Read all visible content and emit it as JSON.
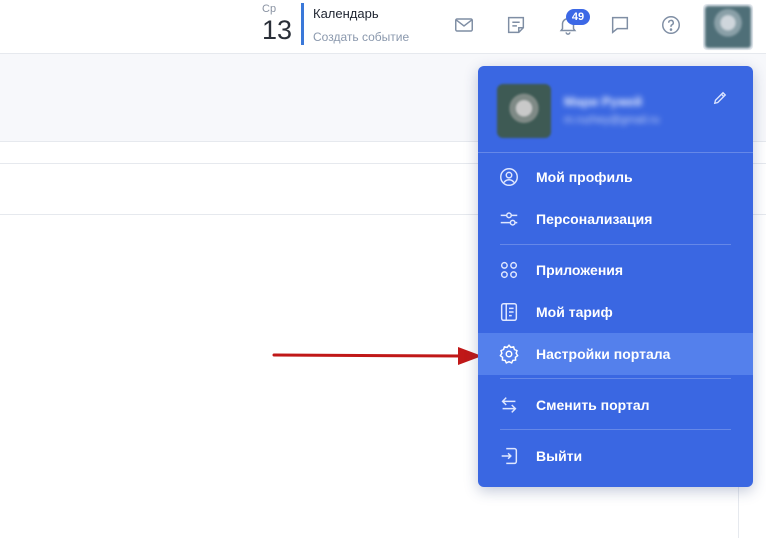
{
  "header": {
    "date_dow": "Ср",
    "date_day": "13",
    "calendar_title": "Календарь",
    "calendar_sub": "Создать событие",
    "notifications_count": "49",
    "accent": "#3a78d9"
  },
  "menu": {
    "user_name": "Мари Ружей",
    "user_email": "m.ruzhey@gmail.ru",
    "items": [
      {
        "label": "Мой профиль",
        "icon": "profile-icon"
      },
      {
        "label": "Персонализация",
        "icon": "sliders-icon"
      },
      {
        "label": "Приложения",
        "icon": "apps-icon"
      },
      {
        "label": "Мой тариф",
        "icon": "tariff-icon"
      },
      {
        "label": "Настройки портала",
        "icon": "gear-icon",
        "active": true
      },
      {
        "label": "Сменить портал",
        "icon": "swap-icon"
      },
      {
        "label": "Выйти",
        "icon": "logout-icon"
      }
    ],
    "bg": "#3a67e2",
    "active_bg": "#5480ec"
  },
  "annotation": {
    "arrow_color": "#c01818"
  }
}
